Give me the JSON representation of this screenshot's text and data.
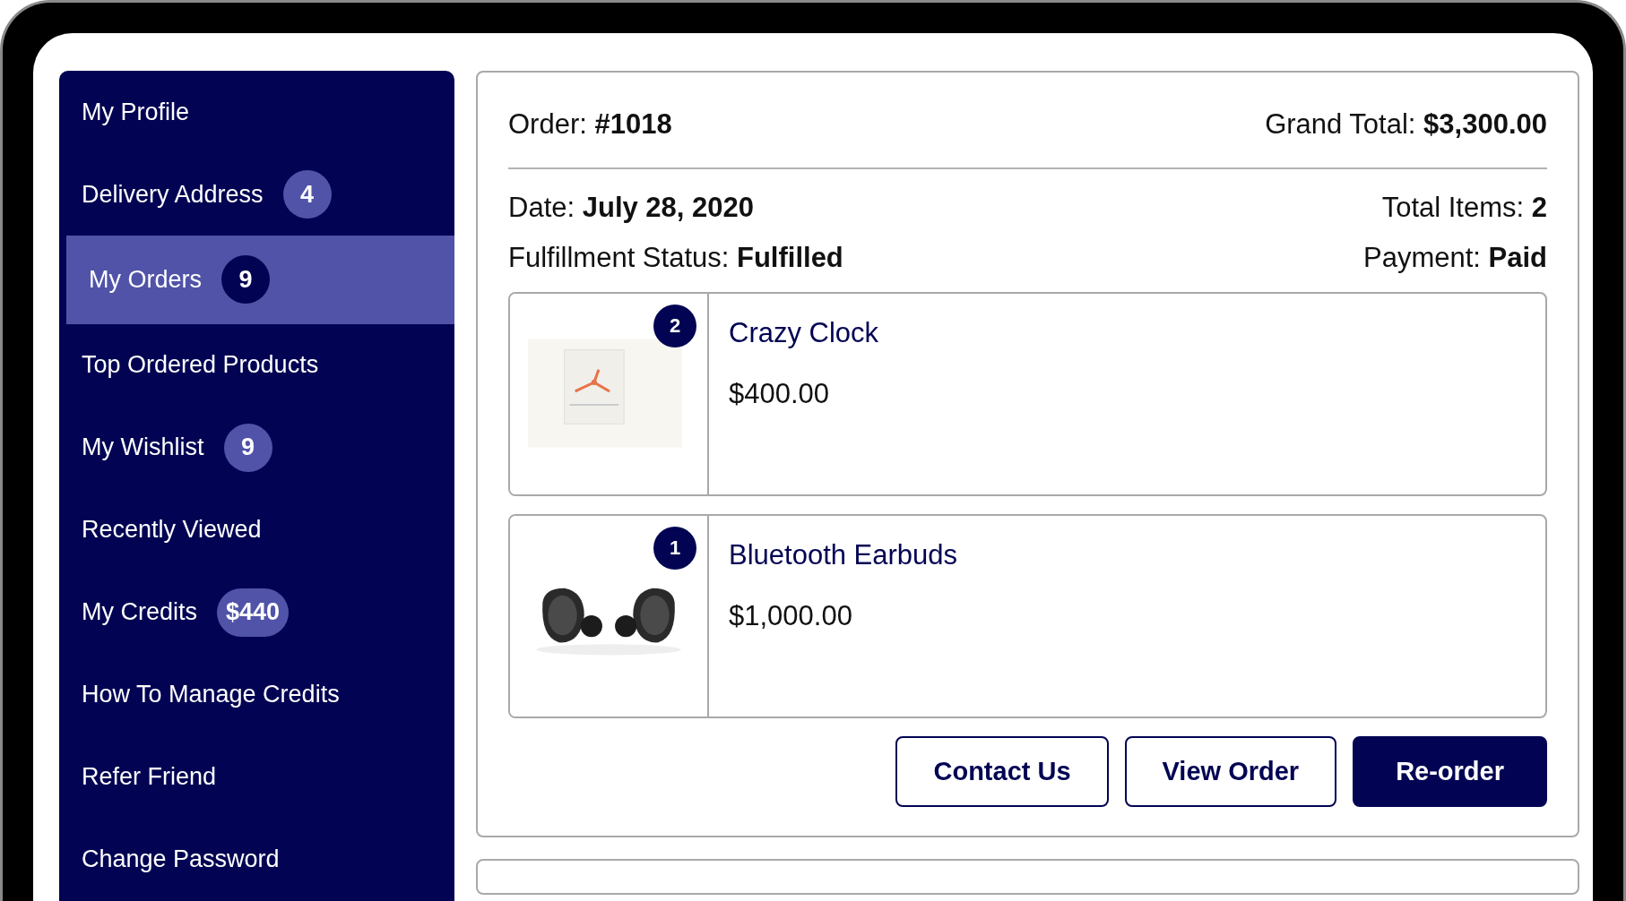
{
  "sidebar": {
    "items": [
      {
        "label": "My Profile",
        "selected": false
      },
      {
        "label": "Delivery Address",
        "badge": "4",
        "selected": false
      },
      {
        "label": "My Orders",
        "badge": "9",
        "selected": true
      },
      {
        "label": "Top Ordered Products",
        "selected": false
      },
      {
        "label": "My Wishlist",
        "badge": "9",
        "selected": false
      },
      {
        "label": "Recently Viewed",
        "selected": false
      },
      {
        "label": "My Credits",
        "badge": "$440",
        "selected": false
      },
      {
        "label": "How To Manage Credits",
        "selected": false
      },
      {
        "label": "Refer Friend",
        "selected": false
      },
      {
        "label": "Change Password",
        "selected": false
      }
    ]
  },
  "order": {
    "number": "Order: **#1018**",
    "grand_total": "Grand Total: **$3,300.00**",
    "date": "Date: **July 28, 2020**",
    "total_items": "Total Items: **2**",
    "fulfillment": "Fulfillment Status: **Fulfilled**",
    "payment": "Payment: **Paid**",
    "items": [
      {
        "name": "Crazy Clock",
        "price": "$400.00",
        "quantity": "2"
      },
      {
        "name": "Bluetooth Earbuds",
        "price": "$1,000.00",
        "quantity": "1"
      }
    ],
    "buttons": [
      {
        "label": "Contact Us",
        "kind": "outline"
      },
      {
        "label": "View Order",
        "kind": "outline"
      },
      {
        "label": "Re-order",
        "kind": "primary"
      }
    ]
  }
}
